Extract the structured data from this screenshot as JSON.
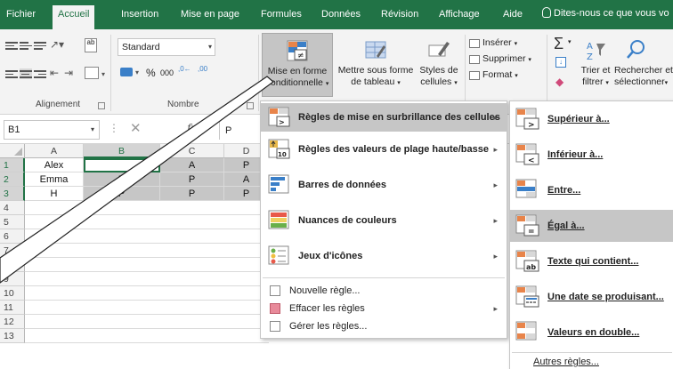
{
  "ribbon_tabs": [
    "Fichier",
    "Accueil",
    "Insertion",
    "Mise en page",
    "Formules",
    "Données",
    "Révision",
    "Affichage",
    "Aide"
  ],
  "active_tab": "Accueil",
  "tell_me": "Dites-nous ce que vous vo",
  "ribbon": {
    "number_format": "Standard",
    "percent": "%",
    "thousands": "000",
    "dec_inc": ",0←",
    "dec_dec": ",00",
    "ab_label": "ab",
    "groups": {
      "alignment": "Alignement",
      "number": "Nombre"
    },
    "cond_format": [
      "Mise en forme",
      "conditionnelle"
    ],
    "format_table": [
      "Mettre sous forme",
      "de tableau"
    ],
    "cell_styles": [
      "Styles de",
      "cellules"
    ],
    "insert": "Insérer",
    "delete": "Supprimer",
    "format": "Format",
    "sort": [
      "Trier et",
      "filtrer"
    ],
    "find": [
      "Rechercher et",
      "sélectionner"
    ]
  },
  "formula_bar": {
    "name_box": "B1",
    "fx": "fx",
    "value": "P"
  },
  "columns": [
    "A",
    "B",
    "C",
    "D"
  ],
  "rows": [
    "1",
    "2",
    "3",
    "4",
    "5",
    "6",
    "7",
    "8",
    "9",
    "10",
    "11",
    "12",
    "13"
  ],
  "cells": {
    "A1": "Alex",
    "A2": "Emma",
    "A3": "H",
    "B2": "P",
    "B3": "P",
    "C1": "A",
    "C2": "P",
    "C3": "P",
    "D1": "P",
    "D2": "A",
    "D3": "P"
  },
  "main_menu": {
    "items": [
      {
        "label": "Règles de mise en surbrillance des cellules",
        "u": "b"
      },
      {
        "label": "Règles des valeurs de plage haute/basse",
        "u": "R"
      },
      {
        "label": "Barres de données",
        "u": "d"
      },
      {
        "label": "Nuances de couleurs",
        "u": "s"
      },
      {
        "label": "Jeux d'icônes",
        "u": "J"
      }
    ],
    "small_items": [
      "Nouvelle règle...",
      "Effacer les règles",
      "Gérer les règles..."
    ]
  },
  "sub_menu": {
    "items": [
      "Supérieur à...",
      "Inférieur à...",
      "Entre...",
      "Égal à...",
      "Texte qui contient...",
      "Une date se produisant...",
      "Valeurs en double..."
    ],
    "more": "Autres règles..."
  },
  "colors": {
    "excel_green": "#217346",
    "hover_grey": "#c6c6c6"
  }
}
